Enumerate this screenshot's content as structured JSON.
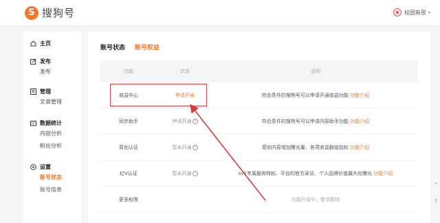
{
  "header": {
    "logo_mark": "S",
    "logo_text": "搜狗号",
    "user_name": "校园有思",
    "caret": "▾"
  },
  "sidebar": {
    "home": "主页",
    "publish": {
      "label": "发布",
      "items": [
        "发布"
      ]
    },
    "manage": {
      "label": "管理",
      "items": [
        "文章管理"
      ]
    },
    "stats": {
      "label": "数据统计",
      "items": [
        "内容分析",
        "粉丝分析"
      ]
    },
    "settings": {
      "label": "设置",
      "items": [
        "账号状态",
        "账号信息"
      ]
    },
    "active_item": "账号状态"
  },
  "tabs": [
    "账号状态",
    "账号权益"
  ],
  "active_tab": "账号权益",
  "table": {
    "headers": [
      "功能",
      "状态",
      "说明"
    ],
    "rows": [
      {
        "name": "收益中心",
        "status": "申请开通",
        "desc": "符合条件的搜狗号可以申请开通收益功能",
        "link": "功能介绍",
        "help": false,
        "status_style": "highlight"
      },
      {
        "name": "同步助手",
        "status": "申请开通",
        "desc": "符合条件的搜狗号可以申请内容助手功能",
        "link": "功能介绍",
        "help": true,
        "status_style": "muted"
      },
      {
        "name": "原创认证",
        "status": "暂未开通",
        "desc": "原创内容增加曝光量、各项收益翻倍加权",
        "link": "功能介绍",
        "help": true,
        "status_style": "muted"
      },
      {
        "name": "红V认证",
        "status": "暂未开通",
        "desc": "sv1专属服务特权、平台的官方采访、个人品牌价值最大化曝光",
        "link": "功能介绍",
        "help": true,
        "status_style": "muted"
      },
      {
        "name": "更多权限",
        "status": "",
        "desc": "功能升级中，敬请期待",
        "link": "",
        "help": false,
        "status_style": "muted"
      }
    ],
    "help_glyph": "?"
  },
  "side_tools": [
    "^",
    "↑"
  ],
  "colors": {
    "accent": "#f0782c",
    "annotation": "#d63c3c"
  }
}
